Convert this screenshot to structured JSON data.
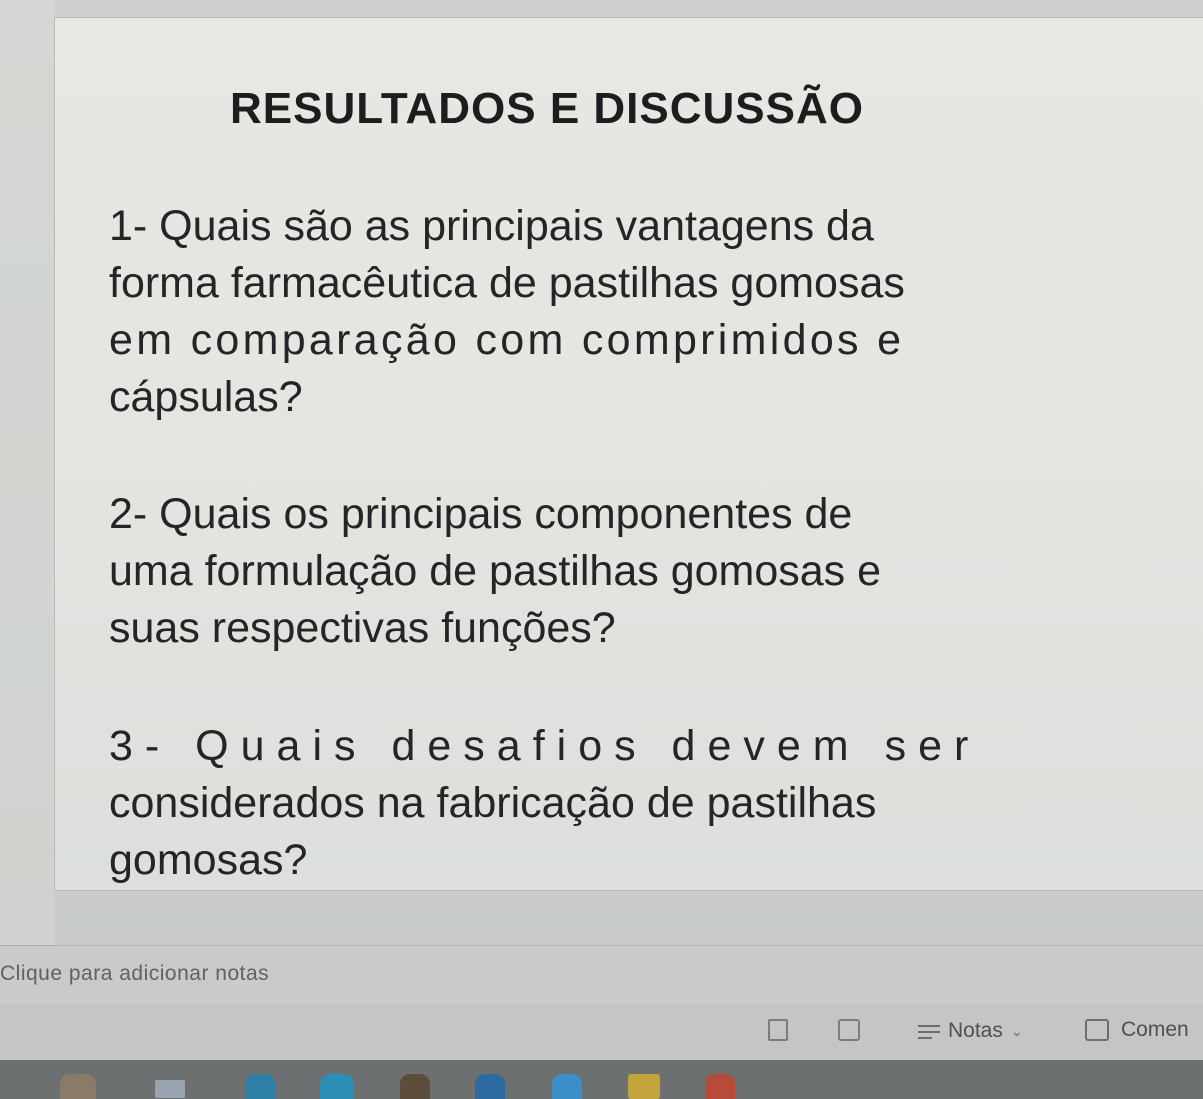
{
  "slide": {
    "title": "RESULTADOS E DISCUSSÃO",
    "questions": [
      {
        "lines": [
          "1- Quais são as principais vantagens da",
          "forma farmacêutica de pastilhas gomosas",
          "em comparação com comprimidos e",
          "cápsulas?"
        ]
      },
      {
        "lines": [
          "2- Quais os principais componentes de",
          "uma formulação de pastilhas gomosas e",
          "suas respectivas funções?"
        ]
      },
      {
        "lines": [
          "3- Quais desafios devem ser",
          "considerados na fabricação de pastilhas",
          "gomosas?"
        ]
      }
    ]
  },
  "notes": {
    "placeholder": "Clique para adicionar notas"
  },
  "status_bar": {
    "notes_label": "Notas",
    "comments_label": "Comen"
  },
  "colors": {
    "slide_background": "#e4e6e2",
    "text": "#242524",
    "taskbar": "#6d7071"
  },
  "icons": {
    "notes": "notes-icon",
    "comments": "comment-icon",
    "chevron": "chevron-down-icon"
  }
}
